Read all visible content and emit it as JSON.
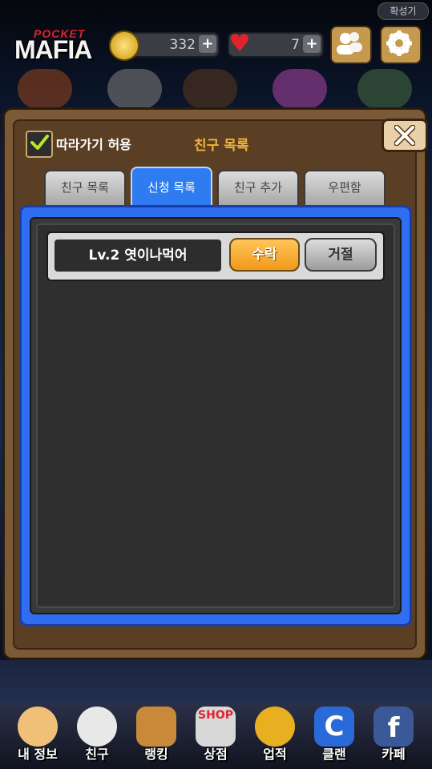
{
  "header": {
    "top_chip": "확성기",
    "logo_small": "POCKET",
    "logo_big": "MAFIA",
    "coins": "332",
    "hearts": "7"
  },
  "modal": {
    "follow_label": "따라가기 허용",
    "title": "친구 목록",
    "tabs": [
      {
        "label": "친구 목록"
      },
      {
        "label": "신청 목록"
      },
      {
        "label": "친구 추가"
      },
      {
        "label": "우편함"
      }
    ],
    "request": {
      "name": "Lv.2 엿이나먹어",
      "accept": "수락",
      "reject": "거절"
    }
  },
  "bottom_nav": [
    {
      "label": "내 정보"
    },
    {
      "label": "친구"
    },
    {
      "label": "랭킹"
    },
    {
      "label": "상점",
      "badge": "SHOP"
    },
    {
      "label": "업적"
    },
    {
      "label": "클랜"
    },
    {
      "label": "카페"
    }
  ],
  "colors": {
    "accent": "#2f7cf0",
    "title_orange": "#f0b43c",
    "accept_orange": "#f19a18"
  }
}
